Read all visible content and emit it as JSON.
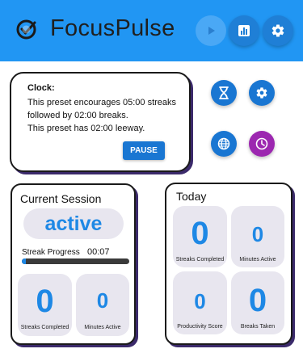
{
  "app": {
    "title": "FocusPulse"
  },
  "icons": {
    "logo": "checkmark-clock-icon",
    "play": "play-icon",
    "stats": "bar-chart-icon",
    "settings": "gear-icon",
    "timer": "hourglass-icon",
    "preset_settings": "gear-icon",
    "language": "globe-icon",
    "history": "clock-icon"
  },
  "colors": {
    "header": "#2196f3",
    "accent": "#1976d2",
    "history": "#9c27b0",
    "value": "#1e88e5"
  },
  "clock": {
    "title": "Clock:",
    "line1": "This preset encourages 05:00 streaks followed by 02:00 breaks.",
    "line2": "This preset has 02:00 leeway.",
    "pause_label": "PAUSE"
  },
  "session": {
    "title": "Current Session",
    "status": "active",
    "streak_label": "Streak Progress",
    "streak_time": "00:07",
    "progress_fraction": 0.04,
    "stats": [
      {
        "value": "0",
        "label": "Streaks Completed"
      },
      {
        "value": "0",
        "label": "Minutes Active"
      }
    ]
  },
  "today": {
    "title": "Today",
    "stats": [
      {
        "value": "0",
        "label": "Streaks Completed"
      },
      {
        "value": "0",
        "label": "Minutes Active"
      },
      {
        "value": "0",
        "label": "Productivity Score"
      },
      {
        "value": "0",
        "label": "Breaks Taken"
      }
    ]
  }
}
